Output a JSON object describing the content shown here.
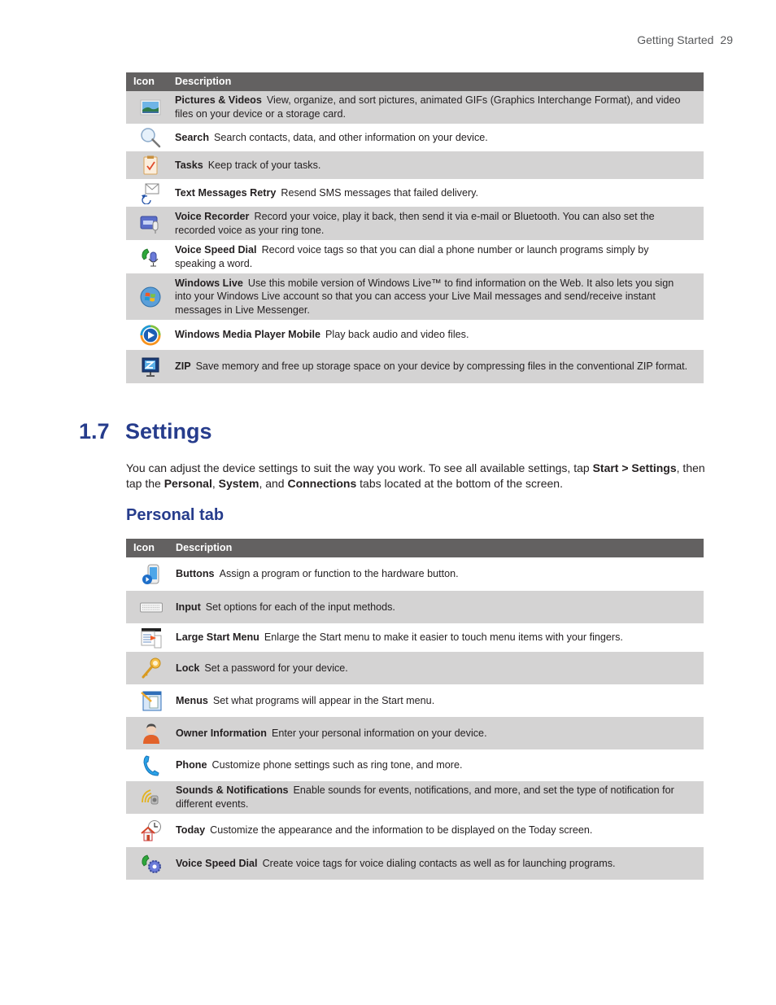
{
  "running_header": {
    "section": "Getting Started",
    "page_number": "29"
  },
  "table1": {
    "headers": {
      "icon": "Icon",
      "description": "Description"
    },
    "rows": [
      {
        "icon": "pictures-videos-icon",
        "name": "Pictures & Videos",
        "description": "View, organize, and sort pictures, animated GIFs (Graphics Interchange Format), and video files on your device or a storage card."
      },
      {
        "icon": "search-icon",
        "name": "Search",
        "description": "Search contacts, data, and other information on your device."
      },
      {
        "icon": "tasks-icon",
        "name": "Tasks",
        "description": "Keep track of your tasks."
      },
      {
        "icon": "text-messages-retry-icon",
        "name": "Text Messages Retry",
        "description": "Resend SMS messages that failed delivery."
      },
      {
        "icon": "voice-recorder-icon",
        "name": "Voice Recorder",
        "description": "Record your voice, play it back, then send it via e-mail or Bluetooth. You can also set the recorded voice as your ring tone."
      },
      {
        "icon": "voice-speed-dial-icon",
        "name": "Voice Speed Dial",
        "description": "Record voice tags so that you can dial a phone number or launch programs simply by speaking a word."
      },
      {
        "icon": "windows-live-icon",
        "name": "Windows Live",
        "description": "Use this mobile version of Windows Live™ to find information on the Web. It also lets you sign into your Windows Live account so that you can access your Live Mail messages and send/receive instant messages in Live Messenger."
      },
      {
        "icon": "windows-media-player-icon",
        "name": "Windows Media Player Mobile",
        "description": "Play back audio and video files."
      },
      {
        "icon": "zip-icon",
        "name": "ZIP",
        "description": "Save memory and free up storage space on your device by compressing files in the conventional ZIP format."
      }
    ]
  },
  "section": {
    "number": "1.7",
    "title": "Settings",
    "intro": {
      "t1": "You can adjust the device settings to suit the way you work. To see all available settings, tap ",
      "b1": "Start > Settings",
      "t2": ", then tap the ",
      "b2": "Personal",
      "t3": ", ",
      "b3": "System",
      "t4": ", and ",
      "b4": "Connections",
      "t5": " tabs located at the bottom of the screen."
    },
    "subsection_title": "Personal tab"
  },
  "table2": {
    "headers": {
      "icon": "Icon",
      "description": "Description"
    },
    "rows": [
      {
        "icon": "buttons-icon",
        "name": "Buttons",
        "description": "Assign a program or function to the hardware button."
      },
      {
        "icon": "input-keyboard-icon",
        "name": "Input",
        "description": "Set options for each of the input methods."
      },
      {
        "icon": "large-start-menu-icon",
        "name": "Large Start Menu",
        "description": "Enlarge the Start menu to make it easier to touch menu items with your fingers."
      },
      {
        "icon": "lock-key-icon",
        "name": "Lock",
        "description": "Set a password for your device."
      },
      {
        "icon": "menus-icon",
        "name": "Menus",
        "description": "Set what programs will appear in the Start menu."
      },
      {
        "icon": "owner-information-icon",
        "name": "Owner Information",
        "description": "Enter your personal information on your device."
      },
      {
        "icon": "phone-icon",
        "name": "Phone",
        "description": "Customize phone settings such as ring tone, and more."
      },
      {
        "icon": "sounds-notifications-icon",
        "name": "Sounds & Notifications",
        "description": "Enable sounds for events, notifications, and more, and set the type of notification for different events."
      },
      {
        "icon": "today-icon",
        "name": "Today",
        "description": "Customize the appearance and the information to be displayed on the Today screen."
      },
      {
        "icon": "voice-speed-dial-settings-icon",
        "name": "Voice Speed Dial",
        "description": "Create voice tags for voice dialing contacts as well as for launching programs."
      }
    ]
  },
  "colors": {
    "heading": "#263c8c",
    "table_header": "#636161",
    "row_shade": "#d4d3d3"
  }
}
